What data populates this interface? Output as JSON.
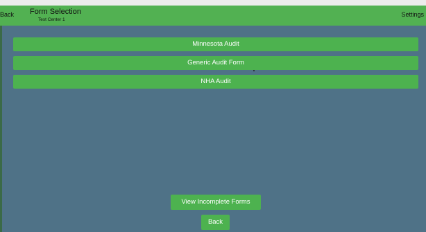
{
  "header": {
    "back_label": "Back",
    "title": "Form Selection",
    "subtitle": "Test Center 1",
    "settings_label": "Settings"
  },
  "forms": [
    {
      "label": "Minnesota Audit"
    },
    {
      "label": "Generic Audit Form"
    },
    {
      "label": "NHA Audit"
    }
  ],
  "footer": {
    "view_incomplete_label": "View Incomplete Forms",
    "back_label": "Back"
  },
  "colors": {
    "background": "#4f7287",
    "accent_green": "#4db24f",
    "header_green": "#52b152"
  }
}
